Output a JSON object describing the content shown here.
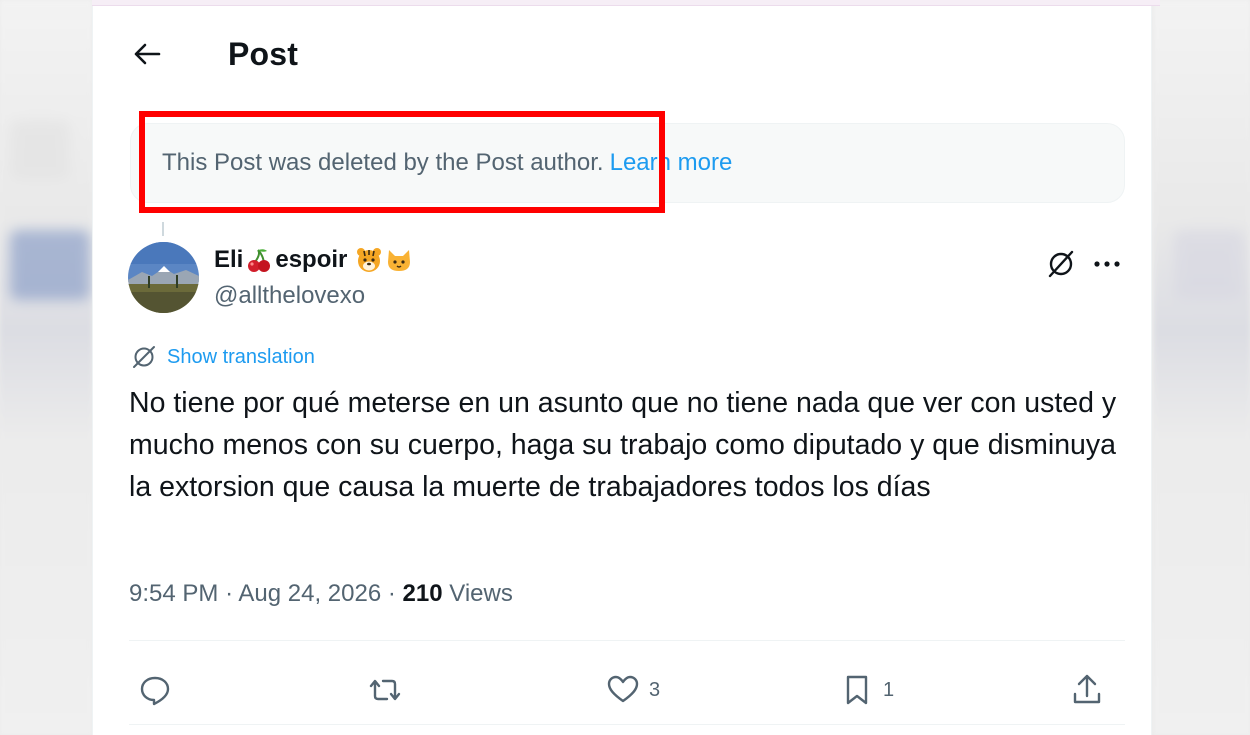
{
  "header": {
    "title": "Post"
  },
  "notice": {
    "text": "This Post was deleted by the Post author.",
    "link_label": "Learn more"
  },
  "author": {
    "name": "Eli",
    "name_suffix": "espoir",
    "handle": "@allthelovexo"
  },
  "post": {
    "translate_label": "Show translation",
    "text": "No tiene por qué meterse en un asunto que no tiene nada que ver con usted y mucho menos con su cuerpo, haga su trabajo como diputado y que disminuya la extorsion que causa la muerte de trabajadores todos los días",
    "time": "9:54 PM",
    "date": "Aug 24, 2026",
    "views_count": "210",
    "views_label": "Views"
  },
  "actions": {
    "reply_count": "",
    "repost_count": "",
    "like_count": "3",
    "bookmark_count": "1"
  },
  "colors": {
    "accent": "#1d9bf0",
    "secondary_text": "#536471",
    "highlight": "#ff0000"
  },
  "icons": [
    "back-arrow-icon",
    "cherry-icon",
    "tiger-icon",
    "cat-icon",
    "grok-icon",
    "more-icon",
    "translate-icon",
    "reply-icon",
    "repost-icon",
    "like-icon",
    "bookmark-icon",
    "share-icon"
  ]
}
